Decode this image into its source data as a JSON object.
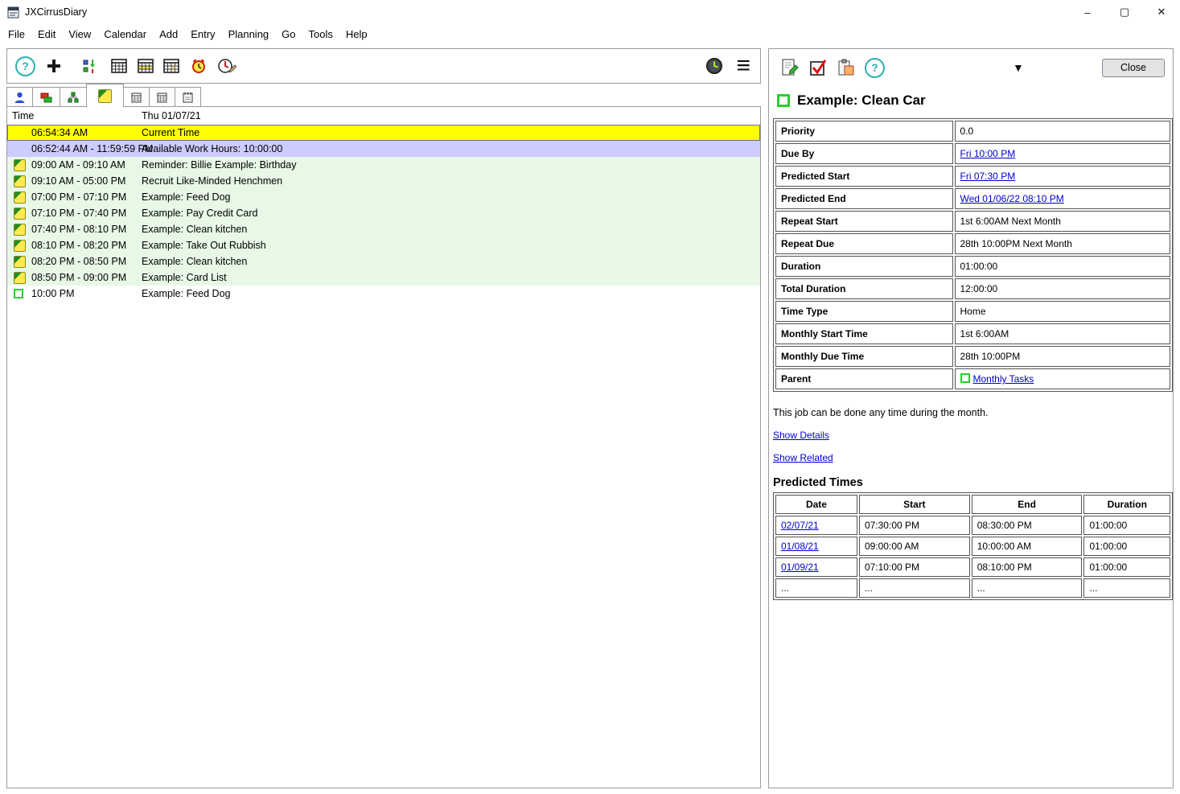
{
  "window": {
    "title": "JXCirrusDiary",
    "controls": {
      "minimize": "–",
      "maximize": "▢",
      "close": "✕"
    }
  },
  "menu": {
    "items": [
      "File",
      "Edit",
      "View",
      "Calendar",
      "Add",
      "Entry",
      "Planning",
      "Go",
      "Tools",
      "Help"
    ]
  },
  "icons": {
    "help_glyph": "?",
    "menu_glyph": "≡",
    "collapse_glyph": "▼",
    "toolbar_icon_names": [
      "help-icon",
      "add-entry-icon",
      "import-calendar-icon",
      "month-view-icon",
      "week-view-icon",
      "day-view-icon",
      "alarm-icon",
      "set-time-icon",
      "clock-icon",
      "menu-icon"
    ],
    "tab_icon_names": [
      "person-icon",
      "tasks-icon",
      "project-tree-icon",
      "note-icon",
      "calendar-icon",
      "calendar-icon",
      "calendar-icon"
    ],
    "detail_icon_names": [
      "edit-entry-icon",
      "complete-entry-icon",
      "copy-entry-icon",
      "help-icon",
      "collapse-icon"
    ]
  },
  "schedule": {
    "header": {
      "time": "Time",
      "date": "Thu 01/07/21"
    },
    "rows": [
      {
        "icon": "",
        "time": "06:54:34 AM",
        "desc": "Current Time",
        "type": "current"
      },
      {
        "icon": "",
        "time": "06:52:44 AM - 11:59:59 PM",
        "desc": "Available Work Hours: 10:00:00",
        "type": "hours"
      },
      {
        "icon": "note",
        "time": "09:00 AM - 09:10 AM",
        "desc": "Reminder: Billie Example: Birthday",
        "type": "task"
      },
      {
        "icon": "note",
        "time": "09:10 AM - 05:00 PM",
        "desc": "Recruit Like-Minded Henchmen",
        "type": "task"
      },
      {
        "icon": "note",
        "time": "07:00 PM - 07:10 PM",
        "desc": "Example: Feed Dog",
        "type": "task"
      },
      {
        "icon": "note",
        "time": "07:10 PM - 07:40 PM",
        "desc": "Example: Pay Credit Card",
        "type": "task"
      },
      {
        "icon": "note",
        "time": "07:40 PM - 08:10 PM",
        "desc": "Example: Clean kitchen",
        "type": "task"
      },
      {
        "icon": "note",
        "time": "08:10 PM - 08:20 PM",
        "desc": "Example: Take Out Rubbish",
        "type": "task"
      },
      {
        "icon": "note",
        "time": "08:20 PM - 08:50 PM",
        "desc": "Example: Clean kitchen",
        "type": "task"
      },
      {
        "icon": "note",
        "time": "08:50 PM - 09:00 PM",
        "desc": "Example: Card List",
        "type": "task"
      },
      {
        "icon": "todo",
        "time": "10:00 PM",
        "desc": "Example: Feed Dog",
        "type": "todo"
      }
    ]
  },
  "details": {
    "title": "Example: Clean Car",
    "close_label": "Close",
    "properties": [
      {
        "label": "Priority",
        "value": "0.0",
        "link": false
      },
      {
        "label": "Due By",
        "value": "Fri 10:00 PM",
        "link": true
      },
      {
        "label": "Predicted Start",
        "value": "Fri 07:30 PM",
        "link": true
      },
      {
        "label": "Predicted End",
        "value": "Wed 01/06/22 08:10 PM",
        "link": true
      },
      {
        "label": "Repeat Start",
        "value": "1st 6:00AM Next Month",
        "link": false
      },
      {
        "label": "Repeat Due",
        "value": "28th 10:00PM Next Month",
        "link": false
      },
      {
        "label": "Duration",
        "value": "01:00:00",
        "link": false
      },
      {
        "label": "Total Duration",
        "value": "12:00:00",
        "link": false
      },
      {
        "label": "Time Type",
        "value": "Home",
        "link": false
      },
      {
        "label": "Monthly Start Time",
        "value": "1st 6:00AM",
        "link": false
      },
      {
        "label": "Monthly Due Time",
        "value": "28th 10:00PM",
        "link": false
      },
      {
        "label": "Parent",
        "value": "Monthly Tasks",
        "link": true,
        "icon": "todo"
      }
    ],
    "note": "This job can be done any time during the month.",
    "show_details_label": "Show Details",
    "show_related_label": "Show Related",
    "predicted": {
      "title": "Predicted Times",
      "columns": [
        "Date",
        "Start",
        "End",
        "Duration"
      ],
      "rows": [
        {
          "date": "02/07/21",
          "start": "07:30:00 PM",
          "end": "08:30:00 PM",
          "duration": "01:00:00",
          "date_link": true
        },
        {
          "date": "01/08/21",
          "start": "09:00:00 AM",
          "end": "10:00:00 AM",
          "duration": "01:00:00",
          "date_link": true
        },
        {
          "date": "01/09/21",
          "start": "07:10:00 PM",
          "end": "08:10:00 PM",
          "duration": "01:00:00",
          "date_link": true
        },
        {
          "date": "...",
          "start": "...",
          "end": "...",
          "duration": "...",
          "date_link": false
        }
      ]
    }
  }
}
